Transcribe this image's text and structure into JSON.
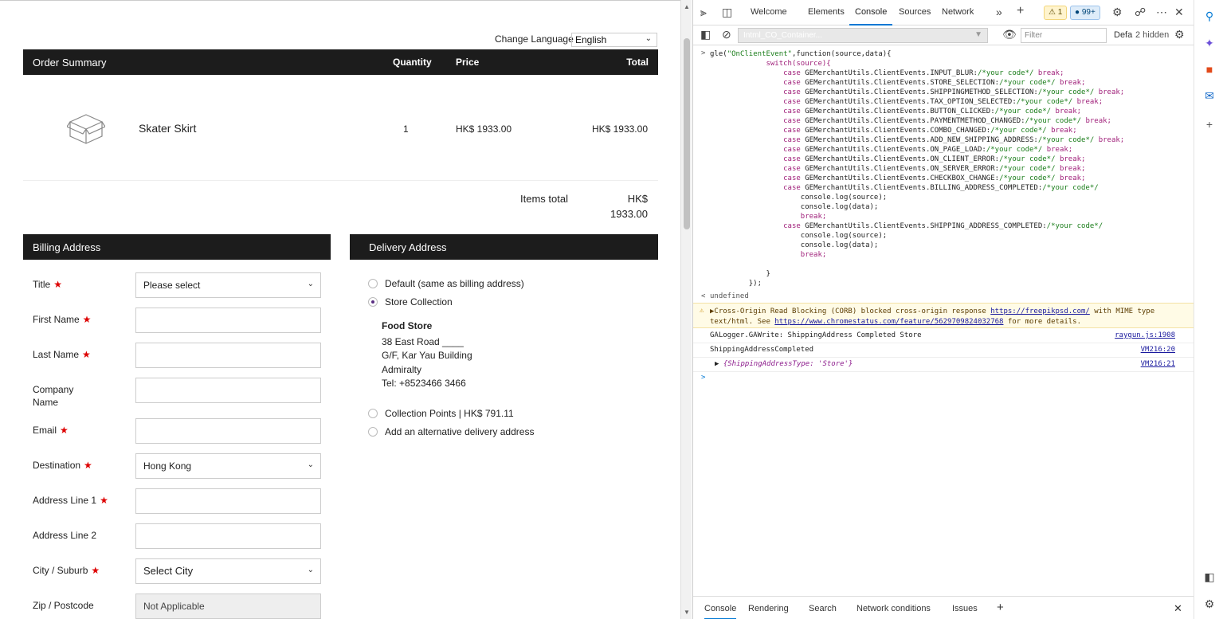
{
  "page": {
    "change_language_label": "Change Language",
    "language_value": "English",
    "order_summary": {
      "title": "Order Summary",
      "col_quantity": "Quantity",
      "col_price": "Price",
      "col_total": "Total",
      "product_name": "Skater Skirt",
      "quantity": "1",
      "price": "HK$ 1933.00",
      "total": "HK$ 1933.00",
      "items_total_label": "Items total",
      "items_total_line1": "HK$",
      "items_total_line2": "1933.00"
    },
    "billing": {
      "title": "Billing Address",
      "title_label": "Title",
      "title_value": "Please select",
      "first_name_label": "First Name",
      "last_name_label": "Last Name",
      "company_label_1": "Company",
      "company_label_2": "Name",
      "email_label": "Email",
      "destination_label": "Destination",
      "destination_value": "Hong Kong",
      "address1_label": "Address Line 1",
      "address2_label": "Address Line 2",
      "city_label": "City / Suburb",
      "city_value": "Select City",
      "zip_label": "Zip / Postcode",
      "zip_value": "Not Applicable",
      "required_mark": "★"
    },
    "delivery": {
      "title": "Delivery Address",
      "option_default": "Default (same as billing address)",
      "option_store": "Store Collection",
      "store_name": "Food Store",
      "store_line1": "38 East  Road ____",
      "store_line2": "G/F, Kar Yau Building",
      "store_line3": "Admiralty",
      "store_phone": "Tel: +8523466  3466",
      "option_points": "Collection Points | HK$ 791.11",
      "option_alt": "Add an alternative delivery address"
    }
  },
  "devtools": {
    "tabs": [
      "Welcome",
      "Elements",
      "Console",
      "Sources",
      "Network"
    ],
    "warning_count": "1",
    "message_count": "99+",
    "context": "Intml_CO_Container...",
    "filter_placeholder": "Filter",
    "levels": "Defa",
    "hidden": "2 hidden",
    "code_head": "gle(\"OnClientEvent\",function(source,data){",
    "code_switch": "switch(source){",
    "cases": [
      "GEMerchantUtils.ClientEvents.INPUT_BLUR:",
      "GEMerchantUtils.ClientEvents.STORE_SELECTION:",
      "GEMerchantUtils.ClientEvents.SHIPPINGMETHOD_SELECTION:",
      "GEMerchantUtils.ClientEvents.TAX_OPTION_SELECTED:",
      "GEMerchantUtils.ClientEvents.BUTTON_CLICKED:",
      "GEMerchantUtils.ClientEvents.PAYMENTMETHOD_CHANGED:",
      "GEMerchantUtils.ClientEvents.COMBO_CHANGED:",
      "GEMerchantUtils.ClientEvents.ADD_NEW_SHIPPING_ADDRESS:",
      "GEMerchantUtils.ClientEvents.ON_PAGE_LOAD:",
      "GEMerchantUtils.ClientEvents.ON_CLIENT_ERROR:",
      "GEMerchantUtils.ClientEvents.ON_SERVER_ERROR:",
      "GEMerchantUtils.ClientEvents.CHECKBOX_CHANGE:"
    ],
    "case_billing": "GEMerchantUtils.ClientEvents.BILLING_ADDRESS_COMPLETED:",
    "case_shipping": "GEMerchantUtils.ClientEvents.SHIPPING_ADDRESS_COMPLETED:",
    "your_code": "/*your code*/",
    "break_kw": "break;",
    "log_source": "console.log(source);",
    "log_data": "console.log(data);",
    "close_brace": "}",
    "close_all": "});",
    "undefined": "undefined",
    "corb_msg_1": "Cross-Origin Read Blocking (CORB) blocked cross-origin response",
    "corb_link": "https://freepikpsd.com/",
    "corb_msg_2": "with MIME",
    "corb_msg_3": "type text/html. See",
    "corb_link2": "https://www.chromestatus.com/feature/5629709824032768",
    "corb_msg_4": "for more details.",
    "log1": "GALogger.GAWrite: ShippingAddress Completed Store",
    "log1_src": "raygun.js:1908",
    "log2": "ShippingAddressCompleted",
    "log2_src": "VM216:20",
    "log3": "{ShippingAddressType: 'Store'}",
    "log3_src": "VM216:21",
    "bottom_tabs": [
      "Console",
      "Rendering",
      "Search",
      "Network conditions",
      "Issues"
    ]
  },
  "colors": {
    "bar": "#1c1c1c",
    "required": "#dd0000",
    "accent": "#0078d4"
  }
}
